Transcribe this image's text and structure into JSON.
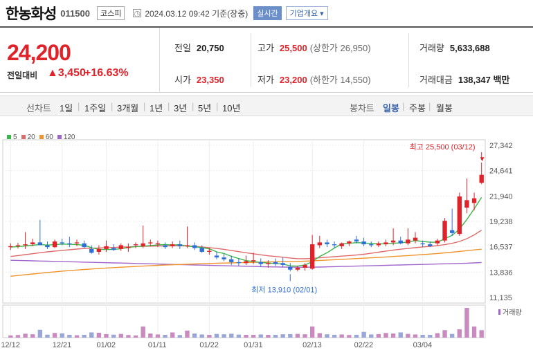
{
  "header": {
    "stock_name": "한농화성",
    "stock_code": "011500",
    "market_badge": "코스피",
    "clock_icon": "clock-icon",
    "timestamp": "2024.03.12 09:42 기준(장중)",
    "realtime_label": "실시간",
    "company_info_label": "기업개요 ▾"
  },
  "summary": {
    "current_price": "24,200",
    "change_label": "전일대비",
    "change_value": "▲3,450",
    "change_percent": "+16.63%",
    "prev_close_label": "전일",
    "prev_close": "20,750",
    "open_label": "시가",
    "open": "23,350",
    "high_label": "고가",
    "high": "25,500",
    "upper_limit": "(상한가 26,950)",
    "low_label": "저가",
    "low": "23,200",
    "lower_limit": "(하한가 14,550)",
    "volume_label": "거래량",
    "volume": "5,633,688",
    "amount_label": "거래대금",
    "amount": "138,347 백만"
  },
  "periods": {
    "line_chart_label": "선차트",
    "line_periods": [
      "1일",
      "1주일",
      "3개월",
      "1년",
      "3년",
      "5년",
      "10년"
    ],
    "candle_chart_label": "봉차트",
    "candle_periods": [
      "일봉",
      "주봉",
      "월봉"
    ],
    "active_candle": "일봉"
  },
  "colors": {
    "up": "#e0222b",
    "down": "#2f6fd6",
    "ma5": "#3ab54a",
    "ma20": "#e06a6a",
    "ma60": "#f0932b",
    "ma120": "#a066cc"
  },
  "chart_data": {
    "type": "candlestick",
    "legend": [
      "5",
      "20",
      "60",
      "120"
    ],
    "y_ticks": [
      "27,342",
      "24,641",
      "21,940",
      "19,238",
      "16,537",
      "13,836",
      "11,135"
    ],
    "ylim": [
      11135,
      27342
    ],
    "x_ticks": [
      "12/12",
      "12/21",
      "01/02",
      "01/11",
      "01/22",
      "01/31",
      "02/13",
      "02/22",
      "03/04"
    ],
    "volume_label": "거래량",
    "high_annotation": "최고 25,500 (03/12)",
    "low_annotation": "최저 13,910 (02/01)",
    "candles": [
      [
        16500,
        16900,
        16200,
        16600,
        120000
      ],
      [
        16600,
        16950,
        16350,
        16700,
        140000
      ],
      [
        16700,
        18100,
        16300,
        16800,
        210000
      ],
      [
        16800,
        17400,
        16600,
        17000,
        180000
      ],
      [
        17000,
        19400,
        16900,
        16700,
        420000
      ],
      [
        16700,
        17100,
        16300,
        16500,
        160000
      ],
      [
        16500,
        17300,
        16400,
        17100,
        250000
      ],
      [
        17000,
        17400,
        16700,
        16900,
        230000
      ],
      [
        16900,
        17600,
        16500,
        16800,
        150000
      ],
      [
        16900,
        17300,
        16600,
        17000,
        130000
      ],
      [
        16900,
        17200,
        16400,
        16500,
        150000
      ],
      [
        16300,
        16700,
        15800,
        15900,
        280000
      ],
      [
        16000,
        16700,
        15700,
        16300,
        260000
      ],
      [
        16300,
        17200,
        16000,
        16600,
        190000
      ],
      [
        16400,
        16800,
        16100,
        16200,
        160000
      ],
      [
        16300,
        16900,
        16100,
        16700,
        200000
      ],
      [
        16400,
        16900,
        16000,
        16500,
        140000
      ],
      [
        16700,
        17000,
        16400,
        16800,
        120000
      ],
      [
        16600,
        18800,
        16400,
        16900,
        600000
      ],
      [
        16900,
        17300,
        16600,
        17000,
        220000
      ],
      [
        16800,
        17200,
        16500,
        16900,
        170000
      ],
      [
        16700,
        17000,
        16300,
        16500,
        150000
      ],
      [
        16600,
        17100,
        16400,
        16800,
        280000
      ],
      [
        16800,
        17200,
        16300,
        16600,
        140000
      ],
      [
        16600,
        18700,
        16400,
        16700,
        380000
      ],
      [
        16700,
        17000,
        16200,
        16400,
        220000
      ],
      [
        16400,
        16700,
        15900,
        16000,
        170000
      ],
      [
        16000,
        16400,
        15700,
        16100,
        150000
      ],
      [
        15600,
        16000,
        15200,
        15400,
        200000
      ],
      [
        15400,
        15800,
        15000,
        15200,
        180000
      ],
      [
        15200,
        15600,
        14600,
        14900,
        210000
      ],
      [
        14900,
        15300,
        14500,
        14800,
        160000
      ],
      [
        14800,
        15600,
        14600,
        15000,
        150000
      ],
      [
        15000,
        15900,
        14700,
        15100,
        150000
      ],
      [
        14900,
        15300,
        14400,
        14700,
        170000
      ],
      [
        14700,
        15100,
        14300,
        14800,
        150000
      ],
      [
        14900,
        15300,
        14500,
        14700,
        150000
      ],
      [
        14800,
        15400,
        14400,
        14600,
        180000
      ],
      [
        14400,
        14800,
        13910,
        14100,
        190000
      ],
      [
        14100,
        14500,
        13910,
        14300,
        200000
      ],
      [
        14300,
        14800,
        14000,
        14600,
        180000
      ],
      [
        14200,
        17800,
        14100,
        16800,
        600000
      ],
      [
        16700,
        17700,
        16400,
        17000,
        240000
      ],
      [
        17000,
        17300,
        16500,
        16800,
        180000
      ],
      [
        16800,
        17100,
        16400,
        16700,
        150000
      ],
      [
        16600,
        17000,
        16300,
        16900,
        170000
      ],
      [
        16900,
        17200,
        16600,
        17100,
        140000
      ],
      [
        17300,
        17700,
        16900,
        17100,
        150000
      ],
      [
        17100,
        17500,
        16600,
        16800,
        310000
      ],
      [
        16800,
        17100,
        16500,
        16700,
        170000
      ],
      [
        16700,
        17100,
        16500,
        16900,
        190000
      ],
      [
        16800,
        17300,
        16600,
        17000,
        250000
      ],
      [
        17000,
        18500,
        16700,
        17200,
        220000
      ],
      [
        17200,
        17600,
        16800,
        16900,
        280000
      ],
      [
        16900,
        18500,
        16700,
        17300,
        200000
      ],
      [
        17200,
        18100,
        16900,
        17500,
        170000
      ],
      [
        16900,
        17200,
        16500,
        16800,
        150000
      ],
      [
        16800,
        17100,
        16500,
        16600,
        150000
      ],
      [
        16900,
        17400,
        16700,
        17200,
        240000
      ],
      [
        17200,
        19600,
        17000,
        19300,
        400000
      ],
      [
        18300,
        20600,
        17700,
        18000,
        200000
      ],
      [
        17900,
        22300,
        17700,
        21900,
        450000
      ],
      [
        20700,
        23800,
        20100,
        21500,
        1600000
      ],
      [
        21200,
        22300,
        20400,
        21700,
        600000
      ],
      [
        23350,
        25500,
        23200,
        24200,
        400000
      ]
    ],
    "ma5": [
      16500,
      16560,
      16620,
      16700,
      16780,
      16720,
      16760,
      16820,
      16800,
      16760,
      16700,
      16440,
      16260,
      16240,
      16260,
      16320,
      16460,
      16560,
      16600,
      16660,
      16740,
      16780,
      16720,
      16760,
      16600,
      16540,
      16440,
      16320,
      16000,
      15820,
      15520,
      15280,
      15060,
      14960,
      14860,
      14800,
      14760,
      14700,
      14500,
      14480,
      14600,
      14960,
      15500,
      15900,
      16400,
      16860,
      16900,
      16980,
      16940,
      16880,
      16840,
      16860,
      16900,
      16960,
      17040,
      17200,
      17100,
      17020,
      17020,
      17400,
      17760,
      18420,
      19440,
      20580,
      21800
    ],
    "ma20": [
      15500,
      15600,
      15700,
      15800,
      15900,
      16000,
      16080,
      16150,
      16220,
      16290,
      16350,
      16380,
      16400,
      16430,
      16460,
      16500,
      16530,
      16560,
      16580,
      16600,
      16620,
      16630,
      16640,
      16640,
      16620,
      16580,
      16520,
      16450,
      16360,
      16260,
      16140,
      16020,
      15900,
      15790,
      15680,
      15580,
      15500,
      15420,
      15340,
      15270,
      15260,
      15300,
      15360,
      15420,
      15480,
      15540,
      15600,
      15660,
      15740,
      15840,
      15960,
      16080,
      16180,
      16280,
      16360,
      16440,
      16520,
      16580,
      16660,
      16760,
      16900,
      17100,
      17400,
      17800,
      18300
    ],
    "ma60": [
      13400,
      13480,
      13560,
      13640,
      13720,
      13800,
      13870,
      13940,
      14000,
      14060,
      14120,
      14170,
      14220,
      14270,
      14320,
      14360,
      14400,
      14440,
      14480,
      14520,
      14560,
      14590,
      14620,
      14650,
      14680,
      14710,
      14740,
      14760,
      14780,
      14800,
      14820,
      14840,
      14860,
      14880,
      14900,
      14920,
      14940,
      14950,
      14960,
      14980,
      15000,
      15040,
      15080,
      15120,
      15160,
      15200,
      15240,
      15280,
      15320,
      15360,
      15400,
      15450,
      15500,
      15550,
      15600,
      15650,
      15700,
      15760,
      15820,
      15890,
      15960,
      16040,
      16120,
      16200,
      16280
    ],
    "ma120": [
      15100,
      15080,
      15060,
      15040,
      15020,
      15000,
      14980,
      14960,
      14940,
      14920,
      14900,
      14880,
      14860,
      14840,
      14820,
      14800,
      14780,
      14760,
      14740,
      14720,
      14700,
      14680,
      14660,
      14640,
      14620,
      14600,
      14580,
      14560,
      14540,
      14520,
      14500,
      14480,
      14460,
      14440,
      14420,
      14400,
      14390,
      14380,
      14370,
      14360,
      14360,
      14370,
      14380,
      14400,
      14420,
      14440,
      14460,
      14480,
      14500,
      14520,
      14540,
      14560,
      14580,
      14600,
      14620,
      14640,
      14660,
      14680,
      14700,
      14720,
      14740,
      14760,
      14790,
      14820,
      14860
    ]
  }
}
